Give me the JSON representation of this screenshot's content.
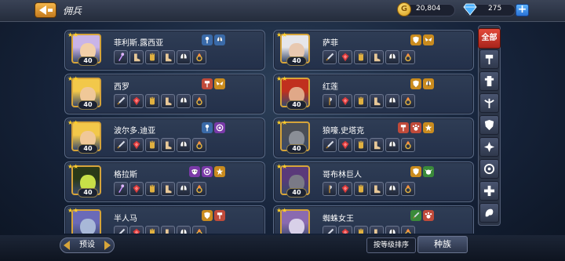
{
  "topbar": {
    "title": "佣兵",
    "gold": "20,804",
    "gems": "275",
    "gold_symbol": "G",
    "plus_symbol": "+"
  },
  "cards": [
    {
      "name": "菲利斯.露西亚",
      "level": "40",
      "stars": "★★",
      "face": "#f2cfa8",
      "hair": "#c9b4e8",
      "tags": [
        {
          "icon": "mace-icon",
          "color": "#3a6aa8"
        },
        {
          "icon": "helmet-icon",
          "color": "#3a6aa8"
        }
      ],
      "eq": [
        "staff-icon",
        "boots-icon",
        "gauntlet-icon",
        "boots-icon",
        "helmet-icon",
        "ring-icon"
      ]
    },
    {
      "name": "萨菲",
      "level": "40",
      "stars": "★★",
      "face": "#e8c8b0",
      "hair": "#e6e6ea",
      "tags": [
        {
          "icon": "shield-icon",
          "color": "#c98b1e"
        },
        {
          "icon": "wings-icon",
          "color": "#c98b1e"
        }
      ],
      "eq": [
        "sword-icon",
        "gem-icon",
        "gauntlet-icon",
        "boots-icon",
        "helmet-icon",
        "ring-icon"
      ]
    },
    {
      "name": "西罗",
      "level": "40",
      "stars": "★★",
      "face": "#f0c898",
      "hair": "#f2c84a",
      "tags": [
        {
          "icon": "hammer-icon",
          "color": "#c04a3a"
        },
        {
          "icon": "wings-icon",
          "color": "#c98b1e"
        }
      ],
      "eq": [
        "sword-icon",
        "gem-icon",
        "gauntlet-icon",
        "boots-icon",
        "helmet-icon",
        "ring-icon"
      ]
    },
    {
      "name": "红莲",
      "level": "40",
      "stars": "★★",
      "face": "#e0a888",
      "hair": "#c0301e",
      "tags": [
        {
          "icon": "shield-icon",
          "color": "#c98b1e"
        },
        {
          "icon": "helmet-icon",
          "color": "#c98b1e"
        }
      ],
      "eq": [
        "axe-icon",
        "gem-icon",
        "gauntlet-icon",
        "boots-icon",
        "helmet-icon",
        "ring-icon"
      ]
    },
    {
      "name": "波尔多.迪亚",
      "level": "40",
      "stars": "★★",
      "face": "#f0c898",
      "hair": "#f2c84a",
      "tags": [
        {
          "icon": "mace-icon",
          "color": "#3a6aa8"
        },
        {
          "icon": "orb-icon",
          "color": "#7a3aa8"
        }
      ],
      "eq": [
        "sword-icon",
        "gem-icon",
        "gauntlet-icon",
        "boots-icon",
        "helmet-icon",
        "ring-icon"
      ]
    },
    {
      "name": "狼嚎.史塔克",
      "level": "40",
      "stars": "★★",
      "face": "#8a8e96",
      "hair": "#4a4e56",
      "tags": [
        {
          "icon": "hammer-icon",
          "color": "#c04a3a"
        },
        {
          "icon": "paw-icon",
          "color": "#c04a3a"
        },
        {
          "icon": "star-icon",
          "color": "#c98b1e"
        }
      ],
      "eq": [
        "sword-icon",
        "gem-icon",
        "gauntlet-icon",
        "boots-icon",
        "helmet-icon",
        "ring-icon"
      ]
    },
    {
      "name": "格拉斯",
      "level": "40",
      "stars": "★★",
      "face": "#c8e048",
      "hair": "#2a3a18",
      "tags": [
        {
          "icon": "mask-icon",
          "color": "#7a3aa8"
        },
        {
          "icon": "orb-icon",
          "color": "#7a3aa8"
        },
        {
          "icon": "star-icon",
          "color": "#c98b1e"
        }
      ],
      "eq": [
        "staff-icon",
        "gem-icon",
        "gauntlet-icon",
        "boots-icon",
        "helmet-icon",
        "ring-icon"
      ]
    },
    {
      "name": "哥布林巨人",
      "level": "40",
      "stars": "★★",
      "face": "#7a7a86",
      "hair": "#5a3a7a",
      "tags": [
        {
          "icon": "shield-icon",
          "color": "#c98b1e"
        },
        {
          "icon": "goblin-icon",
          "color": "#3a8a3a"
        }
      ],
      "eq": [
        "axe-icon",
        "gem-icon",
        "gauntlet-icon",
        "boots-icon",
        "helmet-icon",
        "ring-icon"
      ]
    },
    {
      "name": "半人马",
      "level": "",
      "stars": "★★",
      "face": "#a8b8d8",
      "hair": "#6a6ab8",
      "tags": [
        {
          "icon": "shield-icon",
          "color": "#c98b1e"
        },
        {
          "icon": "hammer-icon",
          "color": "#c04a3a"
        }
      ],
      "eq": [
        "sword-icon",
        "gem-icon",
        "gauntlet-icon",
        "boots-icon",
        "helmet-icon",
        "ring-icon"
      ]
    },
    {
      "name": "蜘蛛女王",
      "level": "",
      "stars": "★★",
      "face": "#d8d0e8",
      "hair": "#8a6ab0",
      "tags": [
        {
          "icon": "sword-icon",
          "color": "#3a8a3a"
        },
        {
          "icon": "paw-icon",
          "color": "#c04a3a"
        }
      ],
      "eq": [
        "sword-icon",
        "gem-icon",
        "gauntlet-icon",
        "boots-icon",
        "helmet-icon",
        "ring-icon"
      ]
    }
  ],
  "filters": {
    "all_label": "全部",
    "items": [
      "hammer-icon",
      "totem-icon",
      "crossbow-icon",
      "shield-icon",
      "shuriken-icon",
      "target-icon",
      "cross-icon",
      "dragon-icon"
    ]
  },
  "bottom": {
    "preset_label": "预设",
    "sort_label": "按等级排序",
    "race_label": "种族"
  },
  "colors": {
    "accent_gold": "#d6a43a",
    "all_button": "#d23a2c",
    "card_bg": "#2f3d55"
  }
}
